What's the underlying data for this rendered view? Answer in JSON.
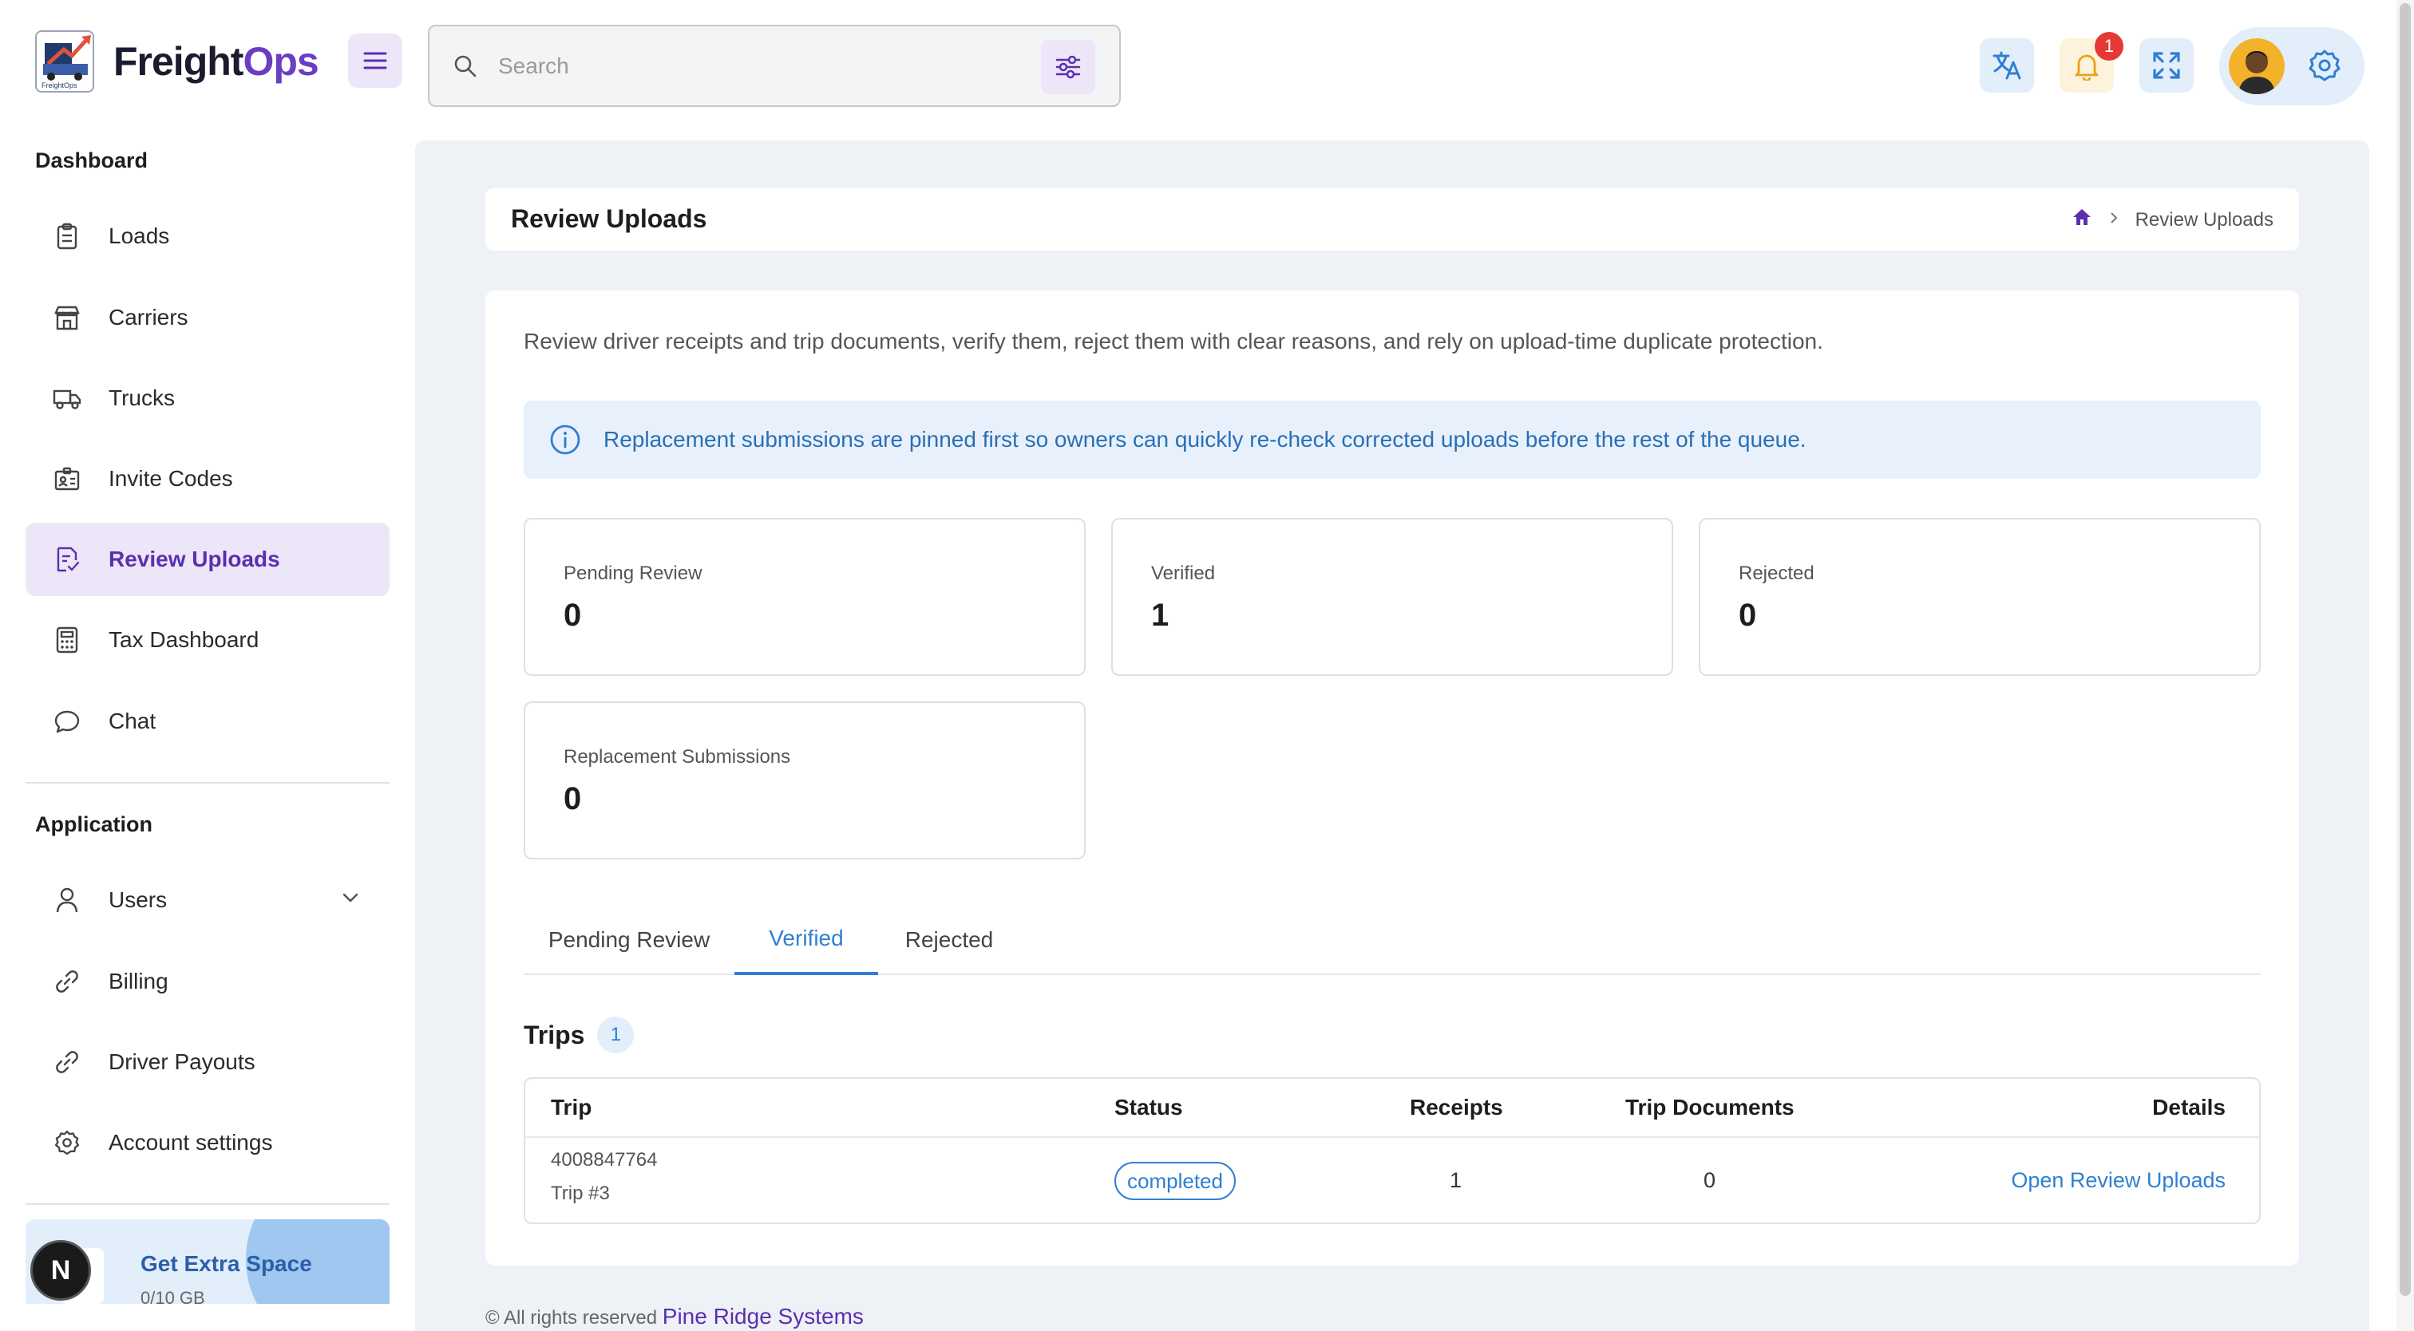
{
  "app": {
    "name_part1": "Freight",
    "name_part2": "Ops",
    "logo_caption": "FreightOps"
  },
  "header": {
    "search_placeholder": "Search",
    "notification_count": "1",
    "icons": [
      "menu-icon",
      "search-icon",
      "filter-icon",
      "translate-icon",
      "bell-icon",
      "fullscreen-icon",
      "gear-icon"
    ]
  },
  "sidebar": {
    "dashboard_title": "Dashboard",
    "dashboard_items": [
      {
        "label": "Loads",
        "icon": "clipboard-icon"
      },
      {
        "label": "Carriers",
        "icon": "store-icon"
      },
      {
        "label": "Trucks",
        "icon": "truck-icon"
      },
      {
        "label": "Invite Codes",
        "icon": "id-card-icon"
      },
      {
        "label": "Review Uploads",
        "icon": "review-doc-icon",
        "active": true
      },
      {
        "label": "Tax Dashboard",
        "icon": "calculator-icon"
      },
      {
        "label": "Chat",
        "icon": "chat-icon"
      }
    ],
    "application_title": "Application",
    "application_items": [
      {
        "label": "Users",
        "icon": "user-icon"
      },
      {
        "label": "Billing",
        "icon": "link-icon"
      },
      {
        "label": "Driver Payouts",
        "icon": "link-icon"
      },
      {
        "label": "Account settings",
        "icon": "gear-icon"
      }
    ],
    "extra_space": {
      "title": "Get Extra Space",
      "subtitle": "0/10 GB"
    },
    "n_badge": "N"
  },
  "page": {
    "title": "Review Uploads",
    "breadcrumb_current": "Review Uploads",
    "intro": "Review driver receipts and trip documents, verify them, reject them with clear reasons, and rely on upload-time duplicate protection.",
    "info": "Replacement submissions are pinned first so owners can quickly re-check corrected uploads before the rest of the queue.",
    "stats": [
      {
        "label": "Pending Review",
        "value": "0"
      },
      {
        "label": "Verified",
        "value": "1"
      },
      {
        "label": "Rejected",
        "value": "0"
      },
      {
        "label": "Replacement Submissions",
        "value": "0"
      }
    ],
    "tabs": [
      {
        "label": "Pending Review"
      },
      {
        "label": "Verified",
        "active": true
      },
      {
        "label": "Rejected"
      }
    ],
    "trips_title": "Trips",
    "trips_count": "1",
    "table": {
      "headers": [
        "Trip",
        "Status",
        "Receipts",
        "Trip Documents",
        "Details"
      ],
      "rows": [
        {
          "trip_id": "4008847764",
          "trip_name": "Trip #3",
          "status": "completed",
          "receipts": "1",
          "trip_documents": "0",
          "details": "Open Review Uploads"
        }
      ]
    },
    "footer_prefix": "© All rights reserved",
    "footer_link": "Pine Ridge Systems"
  },
  "colors": {
    "brand": "#6a3ec2",
    "accent_blue": "#2f7fd3",
    "active_bg": "#ece6f8",
    "main_bg": "#eef1f6",
    "badge_red": "#e53935"
  }
}
